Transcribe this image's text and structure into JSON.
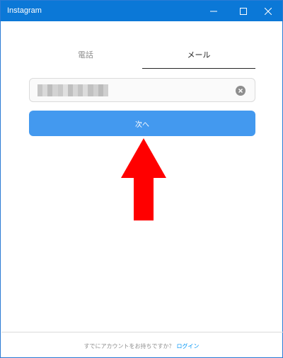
{
  "window": {
    "title": "Instagram",
    "accent_color": "#0b78d7"
  },
  "tabs": [
    {
      "label": "電話",
      "active": false
    },
    {
      "label": "メール",
      "active": true
    }
  ],
  "email_input": {
    "value": "",
    "placeholder": "",
    "clear_icon": "clear-icon"
  },
  "next_button": {
    "label": "次へ",
    "color": "#4399ef"
  },
  "annotation": {
    "icon": "red-arrow-up-icon",
    "color": "#ff0000"
  },
  "footer": {
    "prompt": "すでにアカウントをお持ちですか？",
    "login_link": "ログイン",
    "link_color": "#0095f6"
  }
}
